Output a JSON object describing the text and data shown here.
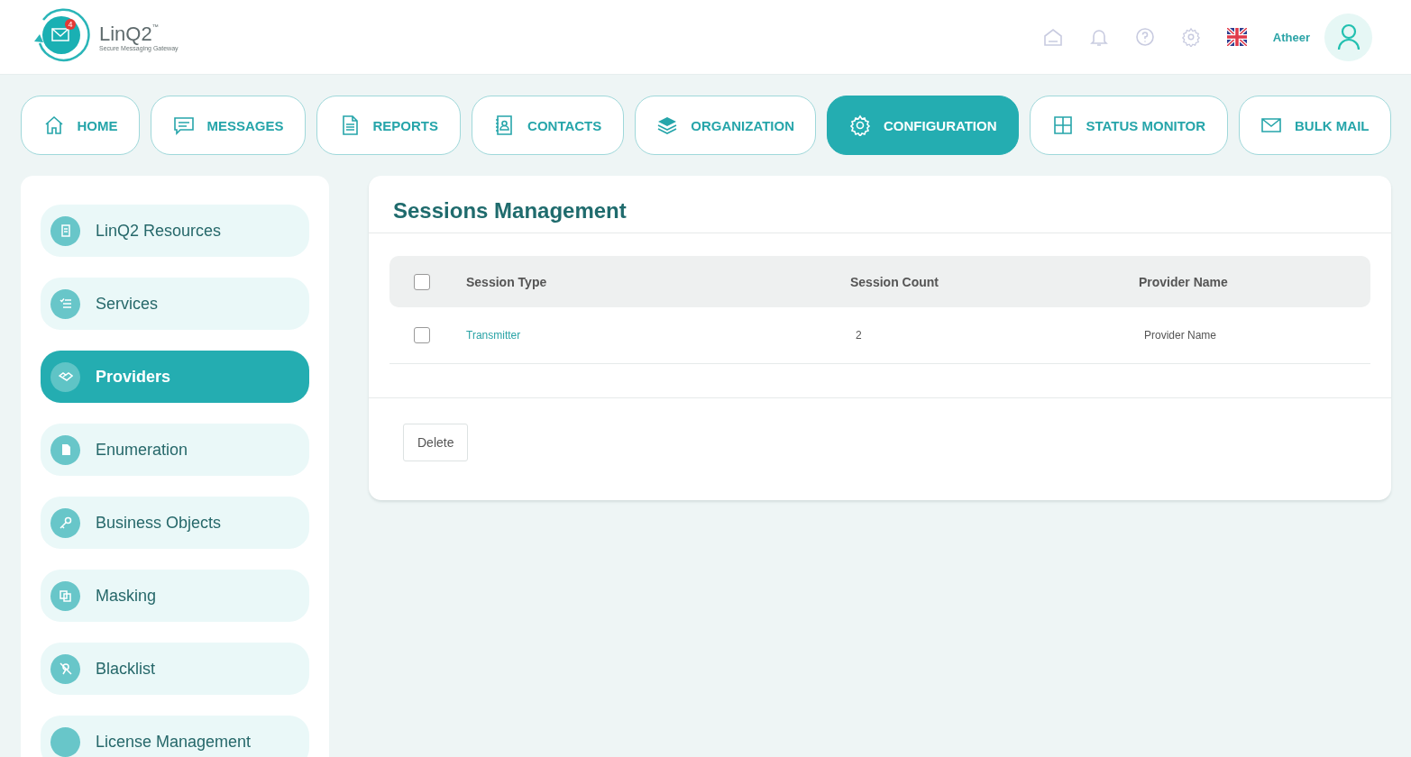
{
  "logo": {
    "name": "LinQ2",
    "trademark": "™",
    "tagline": "Secure Messaging Gateway",
    "badge": "4"
  },
  "header": {
    "user_name": "Atheer"
  },
  "tabs": [
    {
      "label": "HOME",
      "selected": false
    },
    {
      "label": "MESSAGES",
      "selected": false
    },
    {
      "label": "REPORTS",
      "selected": false
    },
    {
      "label": "CONTACTS",
      "selected": false
    },
    {
      "label": "ORGANIZATION",
      "selected": false
    },
    {
      "label": "CONFIGURATION",
      "selected": true
    },
    {
      "label": "STATUS MONITOR",
      "selected": false
    },
    {
      "label": "BULK MAIL",
      "selected": false
    }
  ],
  "sidebar": {
    "items": [
      {
        "label": "LinQ2 Resources",
        "selected": false
      },
      {
        "label": "Services",
        "selected": false
      },
      {
        "label": "Providers",
        "selected": true
      },
      {
        "label": "Enumeration",
        "selected": false
      },
      {
        "label": "Business Objects",
        "selected": false
      },
      {
        "label": "Masking",
        "selected": false
      },
      {
        "label": "Blacklist",
        "selected": false
      },
      {
        "label": "License Management",
        "selected": false
      }
    ]
  },
  "panel": {
    "title": "Sessions Management",
    "table": {
      "columns": [
        "Session Type",
        "Session Count",
        "Provider Name"
      ],
      "all_checked": false,
      "rows": [
        {
          "checked": false,
          "cells": [
            "Transmitter",
            "2",
            "Provider Name"
          ]
        }
      ]
    },
    "buttons": [
      "Delete"
    ]
  }
}
